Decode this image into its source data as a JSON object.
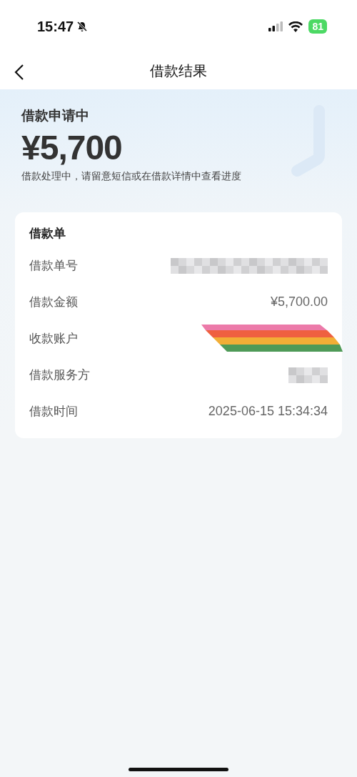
{
  "status_bar": {
    "time": "15:47",
    "silent": true,
    "battery": "81"
  },
  "nav": {
    "title": "借款结果"
  },
  "hero": {
    "status": "借款申请中",
    "amount": "¥5,700",
    "note": "借款处理中，请留意短信或在借款详情中查看进度"
  },
  "card": {
    "title": "借款单",
    "rows": [
      {
        "label": "借款单号",
        "kind": "pixelated"
      },
      {
        "label": "借款金额",
        "kind": "text",
        "value": "¥5,700.00"
      },
      {
        "label": "收款账户",
        "kind": "stripes"
      },
      {
        "label": "借款服务方",
        "kind": "pixelated_short"
      },
      {
        "label": "借款时间",
        "kind": "text",
        "value": "2025-06-15 15:34:34"
      }
    ]
  }
}
